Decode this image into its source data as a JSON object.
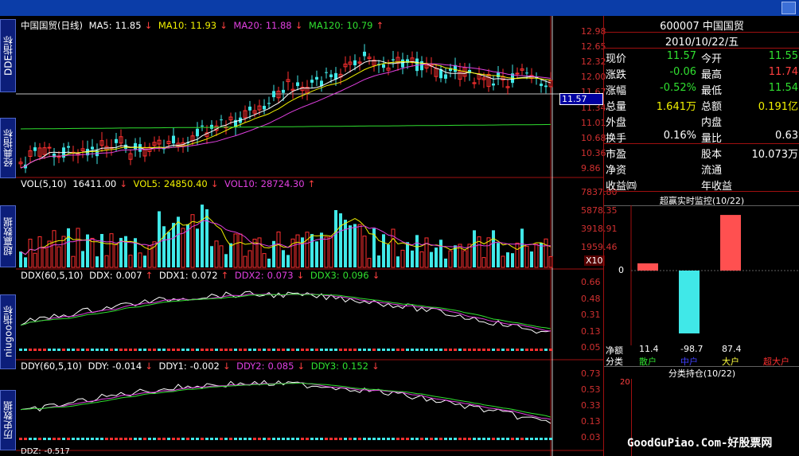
{
  "left_tabs": [
    "DDE指标",
    "经典指标",
    "超赢数据",
    "niugoo指标",
    "历史数据"
  ],
  "main_panel": {
    "title": "中国国贸(日线)",
    "ma5_label": "MA5:",
    "ma5": "11.85",
    "ma10_label": "MA10:",
    "ma10": "11.93",
    "ma20_label": "MA20:",
    "ma20": "11.88",
    "ma120_label": "MA120:",
    "ma120": "10.79",
    "ticks": [
      "12.98",
      "12.65",
      "12.32",
      "12.00",
      "11.67",
      "11.34",
      "11.01",
      "10.68",
      "10.36",
      "9.86"
    ],
    "cursor_price": "11.57"
  },
  "vol_panel": {
    "vol_label": "VOL(5,10)",
    "vol": "16411.00",
    "vol5_label": "VOL5:",
    "vol5": "24850.40",
    "vol10_label": "VOL10:",
    "vol10": "28724.30",
    "ticks": [
      "7837.80",
      "5878.35",
      "3918.91",
      "1959.46"
    ],
    "multiplier": "X10"
  },
  "ddx_panel": {
    "label": "DDX(60,5,10)",
    "ddx_label": "DDX:",
    "ddx": "0.007",
    "ddx1_label": "DDX1:",
    "ddx1": "0.072",
    "ddx2_label": "DDX2:",
    "ddx2": "0.073",
    "ddx3_label": "DDX3:",
    "ddx3": "0.096",
    "ticks": [
      "0.66",
      "0.48",
      "0.31",
      "0.13",
      "0.05"
    ]
  },
  "ddy_panel": {
    "label": "DDY(60,5,10)",
    "ddy_label": "DDY:",
    "ddy": "-0.014",
    "ddy1_label": "DDY1:",
    "ddy1": "-0.002",
    "ddy2_label": "DDY2:",
    "ddy2": "0.085",
    "ddy3_label": "DDY3:",
    "ddy3": "0.152",
    "ticks": [
      "0.73",
      "0.53",
      "0.33",
      "0.13",
      "0.03"
    ],
    "ddz_label": "DDZ:",
    "ddz": "-0.517"
  },
  "quote": {
    "code_name": "600007 中国国贸",
    "date": "2010/10/22/五",
    "rows": [
      {
        "l1": "现价",
        "v1": "11.57",
        "c1": "green",
        "l2": "今开",
        "v2": "11.55",
        "c2": "green"
      },
      {
        "l1": "涨跌",
        "v1": "-0.06",
        "c1": "green",
        "l2": "最高",
        "v2": "11.74",
        "c2": "red"
      },
      {
        "l1": "涨幅",
        "v1": "-0.52%",
        "c1": "green",
        "l2": "最低",
        "v2": "11.54",
        "c2": "green"
      },
      {
        "l1": "总量",
        "v1": "1.641万",
        "c1": "yellow",
        "l2": "总额",
        "v2": "0.191亿",
        "c2": "yellow"
      },
      {
        "l1": "外盘",
        "v1": "",
        "c1": "red",
        "l2": "内盘",
        "v2": "",
        "c2": "green"
      },
      {
        "l1": "换手",
        "v1": "0.16%",
        "c1": "white",
        "l2": "量比",
        "v2": "0.63",
        "c2": "white"
      },
      {
        "l1": "市盈",
        "v1": "",
        "c1": "white",
        "l2": "股本",
        "v2": "10.073万",
        "c2": "white"
      },
      {
        "l1": "净资",
        "v1": "",
        "c1": "white",
        "l2": "流通",
        "v2": "",
        "c2": "white"
      },
      {
        "l1": "收益㈣",
        "v1": "",
        "c1": "white",
        "l2": "年收益",
        "v2": "",
        "c2": "white"
      }
    ]
  },
  "monitor": {
    "title": "超赢实时监控(10/22)",
    "zero": "0",
    "net_label": "净额",
    "class_label": "分类",
    "bars": [
      {
        "name": "散户",
        "value": "11.4",
        "color": "#30e030"
      },
      {
        "name": "中户",
        "value": "-98.7",
        "color": "#4040ff"
      },
      {
        "name": "大户",
        "value": "87.4",
        "color": "#ffff40"
      },
      {
        "name": "超大户",
        "value": "",
        "color": "#ff3030"
      }
    ],
    "holding_title": "分类持仓(10/22)",
    "holding_tick": "20"
  },
  "watermark": "GoodGuPiao.Com-好股票网"
}
